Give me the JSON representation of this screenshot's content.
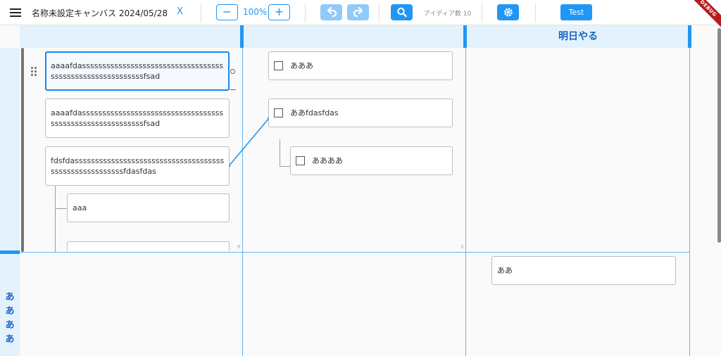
{
  "toolbar": {
    "title": "名称未設定キャンバス 2024/05/28",
    "close_label": "X",
    "zoom_out_label": "−",
    "zoom_level": "100%",
    "zoom_in_label": "+",
    "idea_count": "アイディア数 10",
    "test_label": "Test",
    "icons": {
      "menu": "hamburger-icon",
      "undo": "undo-icon",
      "redo": "redo-icon",
      "search": "search-icon",
      "settings": "gear-icon"
    }
  },
  "debug_banner": "DEBUG",
  "board": {
    "columns": [
      {
        "label": ""
      },
      {
        "label": ""
      },
      {
        "label": "明日やる"
      }
    ],
    "rows": [
      {
        "label": ""
      },
      {
        "label": "ああああ",
        "chars": [
          "あ",
          "あ",
          "あ",
          "あ"
        ]
      }
    ],
    "cell_counts": [
      "6",
      "3"
    ],
    "cards": [
      {
        "text": "aaaafdassssssssssssssssssssssssssssssssssssssssssssssssssssssssssfsad",
        "selected": true
      },
      {
        "text": "aaaafdassssssssssssssssssssssssssssssssssssssssssssssssssssssssssfsad"
      },
      {
        "text": "fdsfdasssssssssssssssssssssssssssssssssssssssssssssssssssssssfdasfdas"
      },
      {
        "text": "aaa"
      },
      {
        "text": ""
      },
      {
        "text": "あああ",
        "checkbox": true
      },
      {
        "text": "ああfdasfdas",
        "checkbox": true
      },
      {
        "text": "ああああ",
        "checkbox": true
      },
      {
        "text": "ああ"
      }
    ]
  },
  "colors": {
    "accent": "#2196f3",
    "header_bg": "#e3f2fd",
    "header_text": "#1565c0",
    "grid": "#64b5f6",
    "disabled": "#90caf9",
    "debug": "#b71c1c"
  }
}
